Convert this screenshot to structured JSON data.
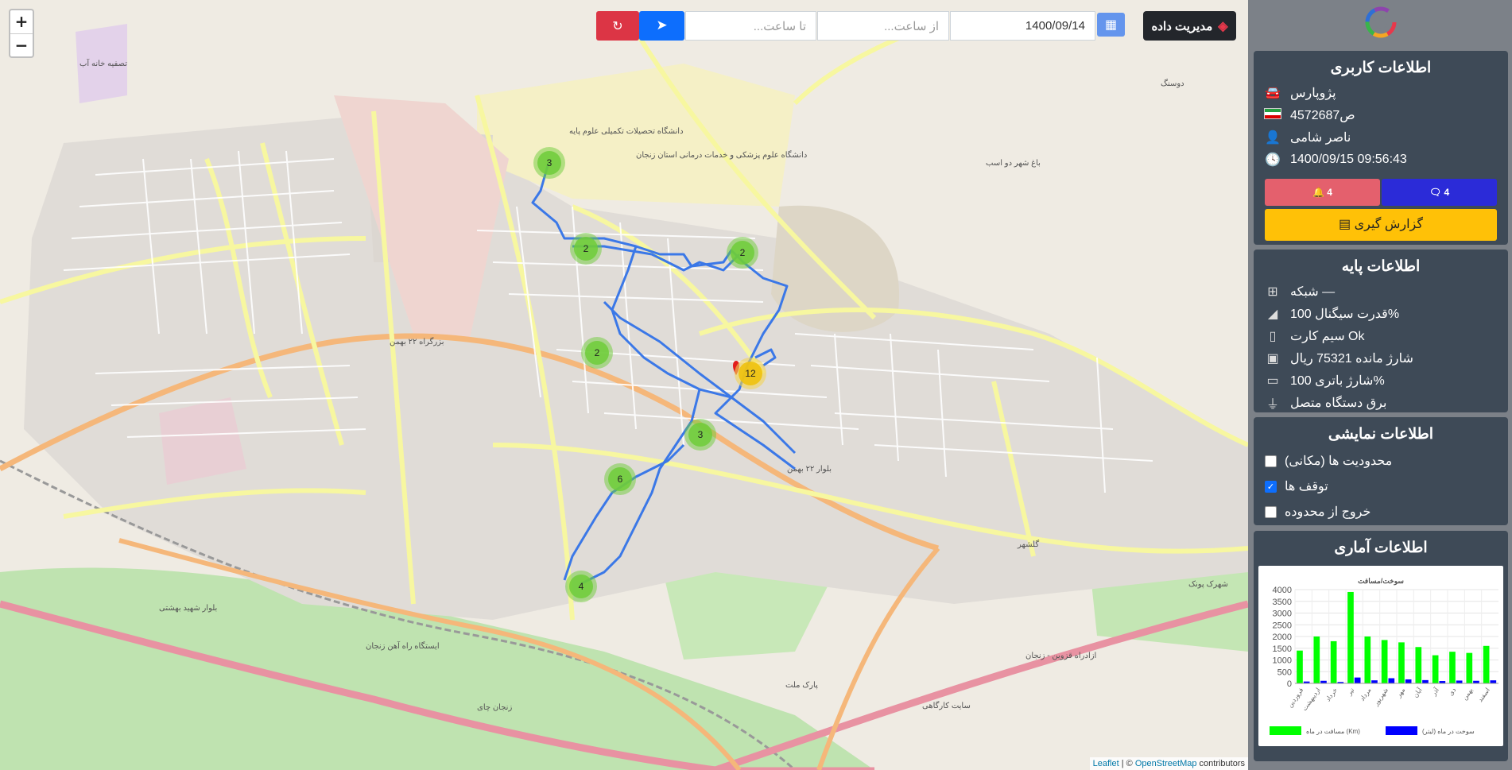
{
  "toolbar": {
    "manage_label": "مدیریت داده",
    "date_value": "1400/09/14",
    "from_placeholder": "از ساعت...",
    "to_placeholder": "تا ساعت..."
  },
  "map": {
    "zoom_in": "+",
    "zoom_out": "−",
    "attribution_leaflet": "Leaflet",
    "attribution_sep": " | © ",
    "attribution_osm": "OpenStreetMap",
    "attribution_tail": " contributors",
    "clusters": [
      {
        "count": "3",
        "kind": "green"
      },
      {
        "count": "2",
        "kind": "green"
      },
      {
        "count": "2",
        "kind": "green"
      },
      {
        "count": "2",
        "kind": "green"
      },
      {
        "count": "12",
        "kind": "orange"
      },
      {
        "count": "3",
        "kind": "green"
      },
      {
        "count": "6",
        "kind": "green"
      },
      {
        "count": "4",
        "kind": "green"
      }
    ],
    "labels": [
      "دانشگاه تحصیلات تکمیلی علوم پایه",
      "دانشگاه علوم پزشکی و خدمات درمانی استان زنجان",
      "بزرگراه ۲۲ بهمن",
      "بلوار ۲۲ بهمن",
      "ایستگاه راه آهن زنجان",
      "پارک ملت",
      "سایت کارگاهی",
      "باغ شهر دو اسب",
      "گلشهر",
      "تصفیه خانه آب",
      "دوسنگ",
      "زنجان چای",
      "شهرک پونک",
      "بلوار شهید بهشتی",
      "ازادراه قزوین - زنجان"
    ]
  },
  "user_info": {
    "title": "اطلاعات کاربری",
    "vehicle": "پژوپارس",
    "plate": "45ص72687",
    "driver": "ناصر شامی",
    "datetime": "1400/09/15 09:56:43",
    "alerts_count": "4",
    "messages_count": "4",
    "report_label": "گزارش گیری"
  },
  "base_info": {
    "title": "اطلاعات پایه",
    "network": "شبکه —",
    "signal": "قدرت سیگنال 100%",
    "sim": "سیم کارت Ok",
    "credit": "شارژ مانده 75321 ریال",
    "battery": "شارژ باتری 100%",
    "power": "برق دستگاه متصل"
  },
  "display_info": {
    "title": "اطلاعات نمایشی",
    "options": [
      {
        "label": "محدودیت ها (مکانی)",
        "checked": false
      },
      {
        "label": "توقف ها",
        "checked": true
      },
      {
        "label": "خروج از محدوده",
        "checked": false
      }
    ]
  },
  "stats": {
    "title": "اطلاعات آماری"
  },
  "colors": {
    "route": "#3b78e7",
    "cluster_green": "#6ecc39",
    "cluster_orange": "#f0c20c",
    "sidebar_bg": "#7c8188",
    "card_bg": "#3e4a57",
    "bar_distance": "#00ff00",
    "bar_fuel": "#0000ff"
  },
  "chart_data": {
    "type": "bar",
    "title": "سوخت/مسافت",
    "categories": [
      "فروردین",
      "اردیبهشت",
      "خرداد",
      "تیر",
      "مرداد",
      "شهریور",
      "مهر",
      "آبان",
      "آذر",
      "دی",
      "بهمن",
      "اسفند"
    ],
    "series": [
      {
        "name": "مسافت در ماه (Km)",
        "values": [
          1400,
          2000,
          1800,
          3900,
          2000,
          1850,
          1750,
          1550,
          1200,
          1350,
          1300,
          1600
        ]
      },
      {
        "name": "سوخت در ماه (لیتر)",
        "values": [
          80,
          110,
          60,
          250,
          130,
          220,
          170,
          140,
          100,
          120,
          110,
          130
        ]
      }
    ],
    "yticks": [
      "0",
      "500",
      "1000",
      "1500",
      "2000",
      "2500",
      "3000",
      "3500",
      "4000"
    ],
    "ylim": [
      0,
      4000
    ],
    "legend": "bottom",
    "grid": true
  }
}
